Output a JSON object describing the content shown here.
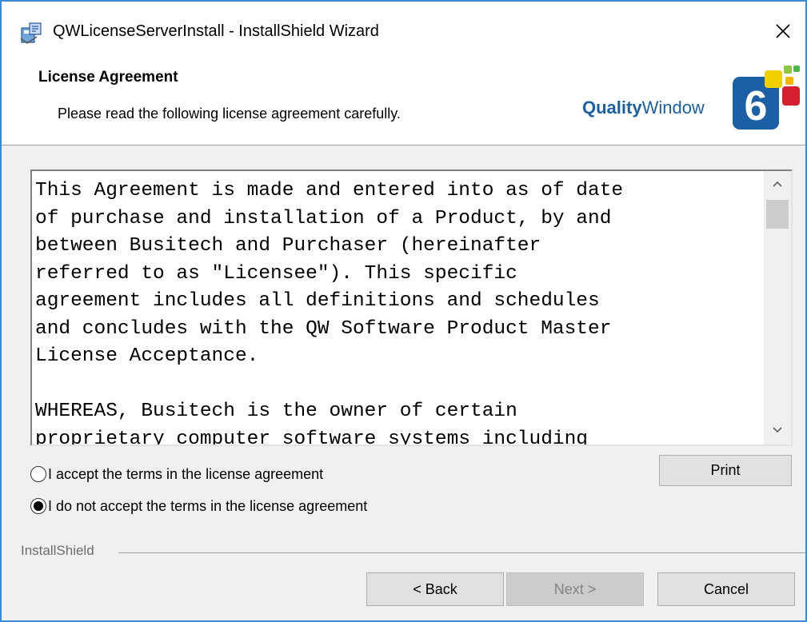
{
  "window": {
    "title": "QWLicenseServerInstall - InstallShield Wizard",
    "accent": "#3c89d8"
  },
  "titlebar": {
    "icon": "installer-package-icon",
    "close_icon": "close-icon"
  },
  "header": {
    "title": "License Agreement",
    "subtitle": "Please read the following license agreement carefully.",
    "logo": {
      "brand_bold": "Quality",
      "brand_regular": "Window",
      "badge_number": "6",
      "colors": [
        "#1b5fa5",
        "#f2b705",
        "#8dc63f",
        "#d6202f",
        "#4cb84c"
      ]
    }
  },
  "license": {
    "text": "This Agreement is made and entered into as of date\nof purchase and installation of a Product, by and\nbetween Busitech and Purchaser (hereinafter\nreferred to as \"Licensee\"). This specific\nagreement includes all definitions and schedules\nand concludes with the QW Software Product Master\nLicense Acceptance.\n\nWHEREAS, Busitech is the owner of certain\nproprietary computer software systems including",
    "scroll_up_icon": "chevron-up-icon",
    "scroll_down_icon": "chevron-down-icon"
  },
  "radios": {
    "accept_label": "I accept the terms in the license agreement",
    "decline_label": "I do not accept the terms in the license agreement",
    "selected": "decline"
  },
  "buttons": {
    "print": "Print",
    "back": "< Back",
    "next": "Next >",
    "cancel": "Cancel",
    "next_enabled": false
  },
  "footer": {
    "brand": "InstallShield"
  }
}
